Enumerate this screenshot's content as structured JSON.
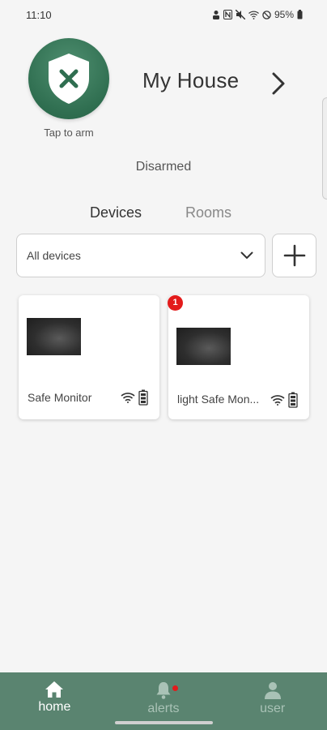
{
  "status_bar": {
    "time": "11:10",
    "battery": "95%"
  },
  "header": {
    "arm_caption": "Tap to arm",
    "house_name": "My House",
    "arm_status": "Disarmed"
  },
  "tabs": [
    {
      "label": "Devices",
      "active": true
    },
    {
      "label": "Rooms",
      "active": false
    }
  ],
  "filter": {
    "selected": "All devices"
  },
  "devices": [
    {
      "name": "Safe Monitor",
      "alert_count": null
    },
    {
      "name": "light Safe Mon...",
      "alert_count": "1"
    }
  ],
  "bottom_nav": [
    {
      "label": "home",
      "active": true
    },
    {
      "label": "alerts",
      "active": false
    },
    {
      "label": "user",
      "active": false
    }
  ],
  "colors": {
    "brand": "#2f6e50",
    "nav_background": "#5a8470",
    "alert_red": "#e31b1b"
  }
}
